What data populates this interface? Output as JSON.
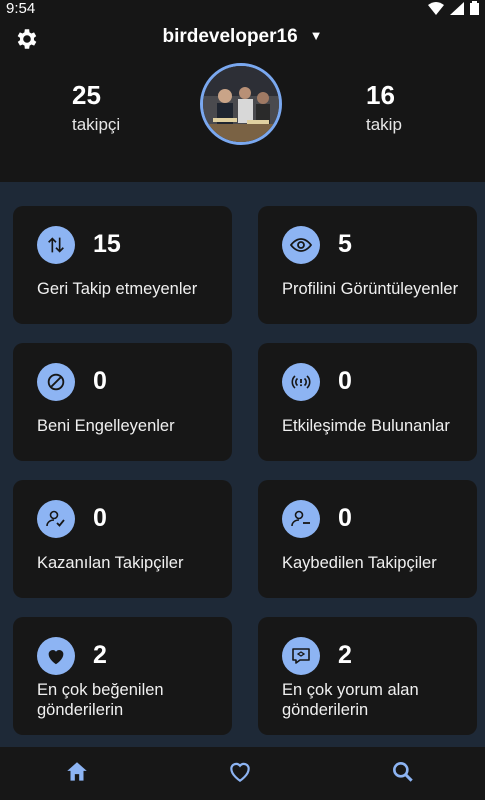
{
  "status": {
    "time": "9:54"
  },
  "header": {
    "username": "birdeveloper16",
    "followers": {
      "count": "25",
      "label": "takipçi"
    },
    "following": {
      "count": "16",
      "label": "takip"
    }
  },
  "cards": [
    {
      "icon": "arrows-up-down-icon",
      "count": "15",
      "label": "Geri Takip etmeyenler"
    },
    {
      "icon": "eye-icon",
      "count": "5",
      "label": "Profilini Görüntüleyenler"
    },
    {
      "icon": "block-icon",
      "count": "0",
      "label": "Beni Engelleyenler"
    },
    {
      "icon": "broadcast-icon",
      "count": "0",
      "label": "Etkileşimde Bulunanlar"
    },
    {
      "icon": "user-add-icon",
      "count": "0",
      "label": "Kazanılan Takipçiler"
    },
    {
      "icon": "user-remove-icon",
      "count": "0",
      "label": "Kaybedilen Takipçiler"
    },
    {
      "icon": "heart-icon",
      "count": "2",
      "label": "En çok beğenilen gönderilerin"
    },
    {
      "icon": "comment-icon",
      "count": "2",
      "label": "En çok yorum alan gönderilerin"
    }
  ],
  "colors": {
    "accent": "#8db4f3",
    "card": "#171717",
    "background": "#1e2937",
    "header": "#161616"
  }
}
